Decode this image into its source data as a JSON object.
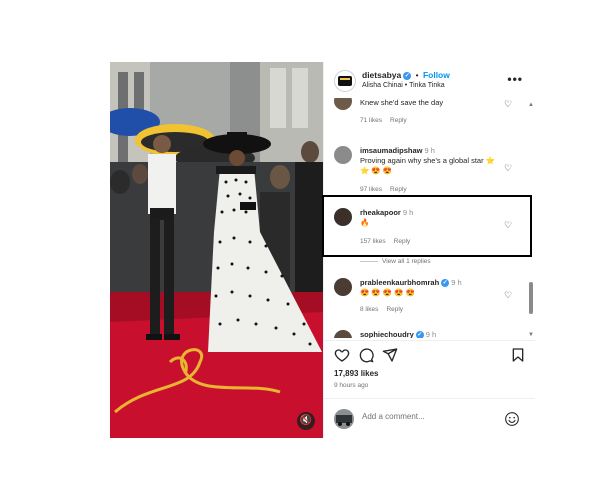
{
  "header": {
    "username": "dietsabya",
    "separator": "•",
    "follow_label": "Follow",
    "subtitle": "Alisha Chinai • Tinka Tinka",
    "more_label": "•••"
  },
  "comments": [
    {
      "text": "Knew she'd save the day",
      "likes": "71 likes",
      "reply": "Reply"
    },
    {
      "user": "imsaumadipshaw",
      "time": "9 h",
      "text": "Proving again why she's a global star ⭐ ⭐ 😍 😍",
      "likes": "97 likes",
      "reply": "Reply"
    },
    {
      "user": "rheakapoor",
      "time": "9 h",
      "text": "🔥",
      "likes": "157 likes",
      "reply": "Reply",
      "view_replies": "View all 1 replies"
    },
    {
      "user": "prableenkaurbhomrah",
      "time": "9 h",
      "text": "😍 😍 😍 😍 😍",
      "likes": "8 likes",
      "reply": "Reply"
    },
    {
      "user": "sophiechoudry",
      "time": "9 h"
    }
  ],
  "post": {
    "likes": "17,893 likes",
    "time_ago": "9 hours ago"
  },
  "add_comment": {
    "placeholder": "Add a comment..."
  },
  "icons": {
    "mute": "mute-icon",
    "like": "heart-icon",
    "comment": "comment-icon",
    "share": "share-icon",
    "save": "bookmark-icon",
    "emoji": "emoji-icon",
    "more": "more-options-icon"
  },
  "colors": {
    "follow": "#0095f6",
    "verified": "#3897f0",
    "red_carpet": "#c8102e",
    "highlight_border": "#000000"
  }
}
